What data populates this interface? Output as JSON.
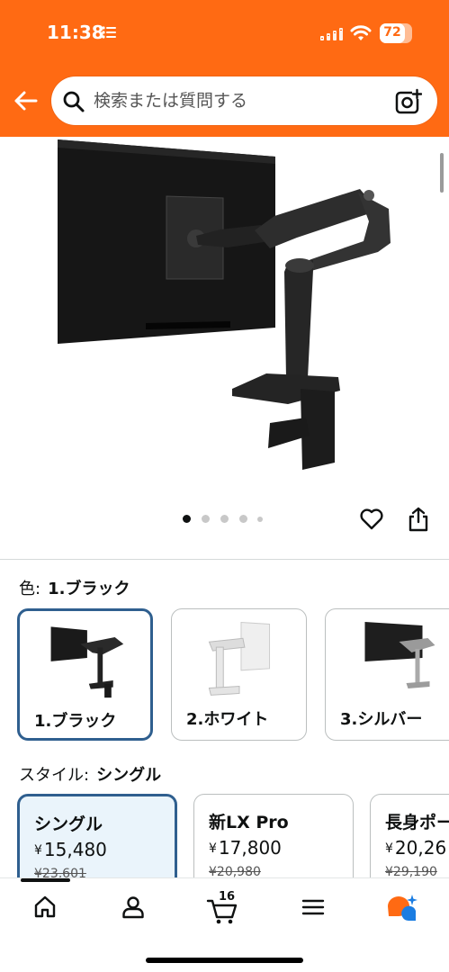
{
  "status_bar": {
    "time": "11:38",
    "battery": "72"
  },
  "search": {
    "placeholder": "検索または質問する"
  },
  "image_carousel": {
    "dots": 5,
    "active": 0
  },
  "color": {
    "label": "色:",
    "value": "1.ブラック",
    "options": [
      {
        "label": "1.ブラック",
        "selected": true
      },
      {
        "label": "2.ホワイト",
        "selected": false
      },
      {
        "label": "3.シルバー",
        "selected": false
      }
    ]
  },
  "style": {
    "label": "スタイル:",
    "value": "シングル",
    "options": [
      {
        "name": "シングル",
        "price": "15,480",
        "old": "¥23,601",
        "selected": true
      },
      {
        "name": "新LX Pro",
        "price": "17,800",
        "old": "¥20,980",
        "selected": false
      },
      {
        "name": "長身ポー",
        "price": "20,26",
        "old": "¥29,190",
        "selected": false
      }
    ]
  },
  "currency_symbol": "¥",
  "bottom_nav": {
    "cart_count": "16"
  },
  "colors": {
    "accent": "#ff6a13",
    "selection_border": "#2f5f8f",
    "selected_bg": "#eaf4fb"
  }
}
